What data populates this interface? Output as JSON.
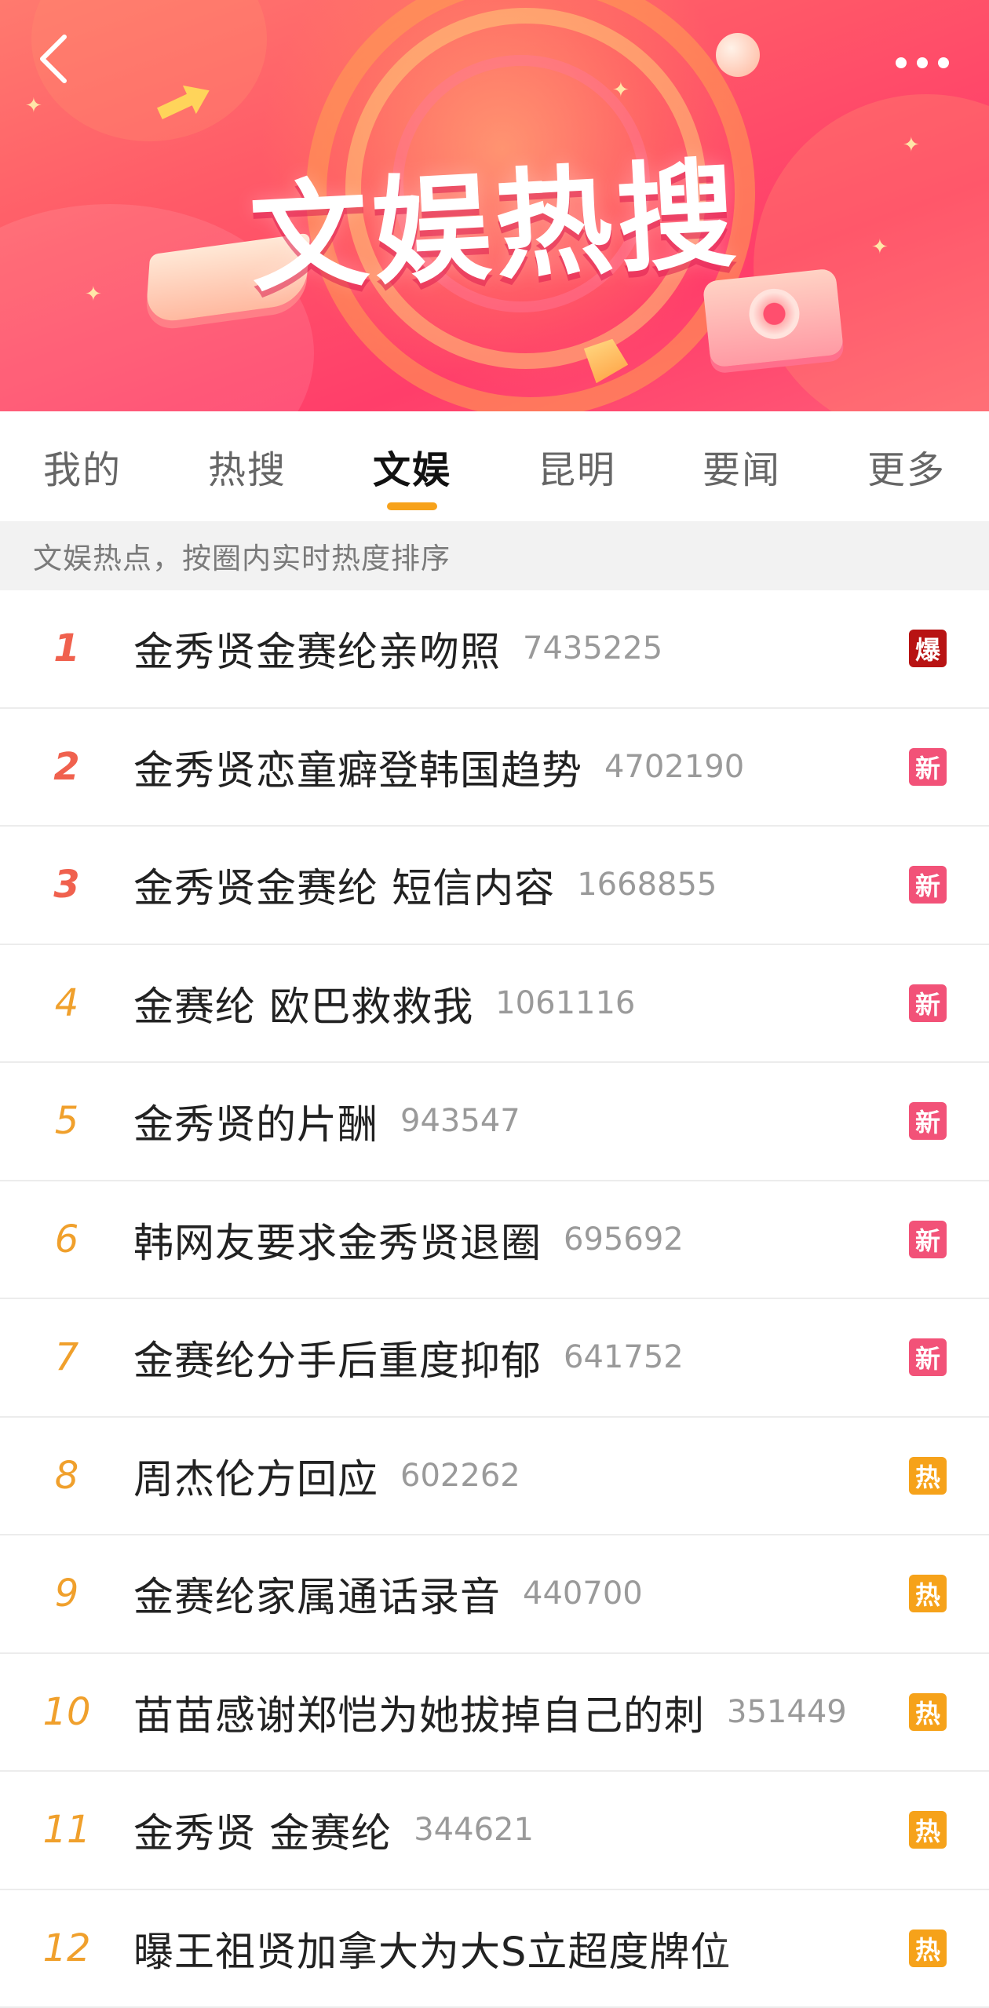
{
  "banner": {
    "title": "文娱热搜",
    "back_icon": "chevron-left-icon",
    "more_icon": "more-dots-icon"
  },
  "tabs": [
    {
      "label": "我的",
      "active": false
    },
    {
      "label": "热搜",
      "active": false
    },
    {
      "label": "文娱",
      "active": true
    },
    {
      "label": "昆明",
      "active": false
    },
    {
      "label": "要闻",
      "active": false
    },
    {
      "label": "更多",
      "active": false
    }
  ],
  "subheader": "文娱热点，按圈内实时热度排序",
  "list": [
    {
      "rank": "1",
      "title": "金秀贤金赛纶亲吻照",
      "count": "7435225",
      "badge": "爆",
      "badge_color": "#b81313"
    },
    {
      "rank": "2",
      "title": "金秀贤恋童癖登韩国趋势",
      "count": "4702190",
      "badge": "新",
      "badge_color": "#f25278"
    },
    {
      "rank": "3",
      "title": "金秀贤金赛纶 短信内容",
      "count": "1668855",
      "badge": "新",
      "badge_color": "#f25278"
    },
    {
      "rank": "4",
      "title": "金赛纶 欧巴救救我",
      "count": "1061116",
      "badge": "新",
      "badge_color": "#f25278"
    },
    {
      "rank": "5",
      "title": "金秀贤的片酬",
      "count": "943547",
      "badge": "新",
      "badge_color": "#f25278"
    },
    {
      "rank": "6",
      "title": "韩网友要求金秀贤退圈",
      "count": "695692",
      "badge": "新",
      "badge_color": "#f25278"
    },
    {
      "rank": "7",
      "title": "金赛纶分手后重度抑郁",
      "count": "641752",
      "badge": "新",
      "badge_color": "#f25278"
    },
    {
      "rank": "8",
      "title": "周杰伦方回应",
      "count": "602262",
      "badge": "热",
      "badge_color": "#f6a21a"
    },
    {
      "rank": "9",
      "title": "金赛纶家属通话录音",
      "count": "440700",
      "badge": "热",
      "badge_color": "#f6a21a"
    },
    {
      "rank": "10",
      "title": "苗苗感谢郑恺为她拔掉自己的刺",
      "count": "351449",
      "badge": "热",
      "badge_color": "#f6a21a"
    },
    {
      "rank": "11",
      "title": "金秀贤 金赛纶",
      "count": "344621",
      "badge": "热",
      "badge_color": "#f6a21a"
    },
    {
      "rank": "12",
      "title": "曝王祖贤加拿大为大S立超度牌位",
      "count": "",
      "badge": "热",
      "badge_color": "#f6a21a"
    }
  ],
  "colors": {
    "accent": "#f7a21b",
    "rank_top": "#f0614e",
    "rank_other": "#f0a02c"
  }
}
